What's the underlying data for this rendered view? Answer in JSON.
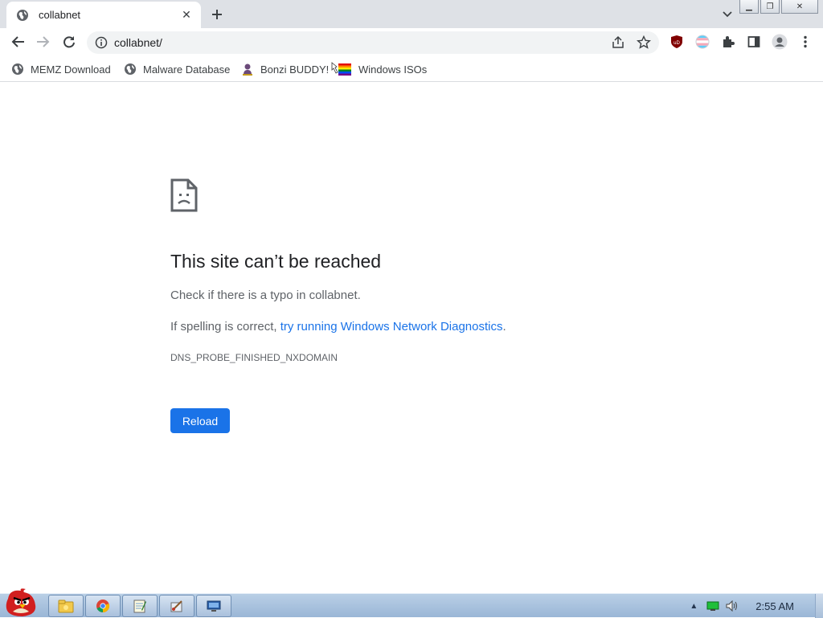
{
  "tab": {
    "title": "collabnet",
    "close_glyph": "✕",
    "new_tab_glyph": "+"
  },
  "window_controls": {
    "minimize": "▁",
    "restore": "❐",
    "close": "✕"
  },
  "toolbar": {
    "url": "collabnet/"
  },
  "bookmarks": [
    {
      "label": "MEMZ Download",
      "icon": "globe-icon"
    },
    {
      "label": "Malware Database",
      "icon": "globe-icon"
    },
    {
      "label": "Bonzi BUDDY!",
      "icon": "bonzi-icon"
    },
    {
      "label": "Windows ISOs",
      "icon": "windows-flag-icon"
    }
  ],
  "error": {
    "title": "This site can’t be reached",
    "p1": "Check if there is a typo in collabnet.",
    "p2_prefix": "If spelling is correct, ",
    "p2_link": "try running Windows Network Diagnostics",
    "p2_suffix": ".",
    "code": "DNS_PROBE_FINISHED_NXDOMAIN",
    "reload_label": "Reload"
  },
  "taskbar": {
    "buttons": [
      "explorer-icon",
      "chrome-icon",
      "notepad-icon",
      "paint-icon",
      "remote-desktop-icon"
    ],
    "clock": "2:55 AM",
    "tray_expand": "▲"
  },
  "colors": {
    "accent": "#1a73e8",
    "tab_strip": "#dee1e6",
    "text": "#202124",
    "secondary_text": "#5f6368"
  }
}
